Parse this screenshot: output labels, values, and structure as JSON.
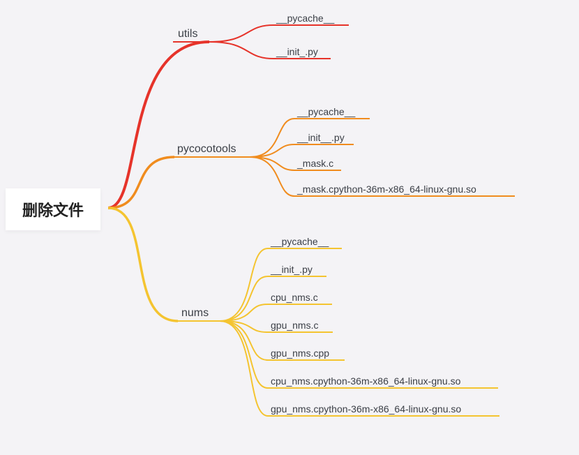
{
  "root": {
    "label": "删除文件"
  },
  "branches": [
    {
      "id": "utils",
      "label": "utils",
      "color": "#e6332a",
      "children": [
        {
          "id": "utils-pycache",
          "label": "__pycache__"
        },
        {
          "id": "utils-init",
          "label": "__init_.py"
        }
      ]
    },
    {
      "id": "pycocotools",
      "label": "pycocotools",
      "color": "#f08c1e",
      "children": [
        {
          "id": "pycoco-pycache",
          "label": "__pycache__"
        },
        {
          "id": "pycoco-init",
          "label": "__init__.py"
        },
        {
          "id": "pycoco-maskc",
          "label": "_mask.c"
        },
        {
          "id": "pycoco-maskso",
          "label": "_mask.cpython-36m-x86_64-linux-gnu.so"
        }
      ]
    },
    {
      "id": "nums",
      "label": "nums",
      "color": "#f4c430",
      "children": [
        {
          "id": "nums-pycache",
          "label": "__pycache__"
        },
        {
          "id": "nums-init",
          "label": "__init_.py"
        },
        {
          "id": "nums-cpunmsc",
          "label": "cpu_nms.c"
        },
        {
          "id": "nums-gpunmsc",
          "label": "gpu_nms.c"
        },
        {
          "id": "nums-gpunmscpp",
          "label": "gpu_nms.cpp"
        },
        {
          "id": "nums-cpunmsso",
          "label": "cpu_nms.cpython-36m-x86_64-linux-gnu.so"
        },
        {
          "id": "nums-gpunmsso",
          "label": "gpu_nms.cpython-36m-x86_64-linux-gnu.so"
        }
      ]
    }
  ]
}
